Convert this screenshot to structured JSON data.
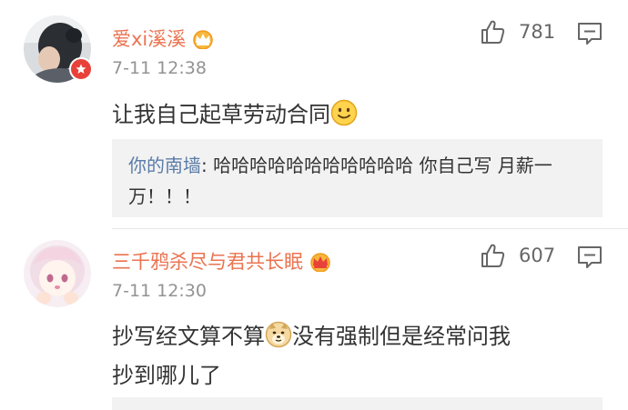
{
  "comments": [
    {
      "username": "爱xi溪溪",
      "time": "7-11 12:38",
      "text": "让我自己起草劳动合同",
      "likes": "781",
      "reply": {
        "user": "你的南墙",
        "text": ": 哈哈哈哈哈哈哈哈哈哈哈 你自己写 月薪一万！！！"
      }
    },
    {
      "username": "三千鸦杀尽与君共长眠",
      "time": "7-11 12:30",
      "text_line1_a": "抄写经文算不算",
      "text_line1_b": "没有强制但是经常问我",
      "text_line2": "抄到哪儿了",
      "likes": "607"
    }
  ],
  "colors": {
    "username": "#eb7350",
    "reply_user": "#5a7ca8",
    "time": "#939393",
    "reply_bg": "#f2f2f2"
  },
  "icons": [
    "thumb-up-icon",
    "comment-icon",
    "crown-icon",
    "smile-emoji",
    "doge-emoji",
    "verified-badge-icon"
  ]
}
